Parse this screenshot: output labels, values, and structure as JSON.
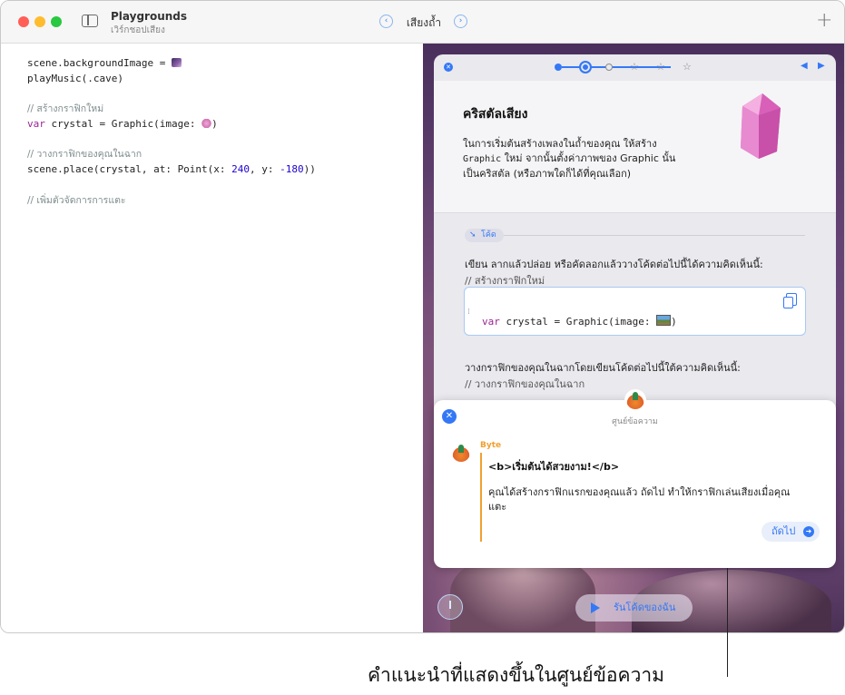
{
  "window": {
    "app_title": "Playgrounds",
    "subtitle": "เวิร์กชอปเสียง",
    "page_name": "เสียงถ้ำ",
    "nav_prev_icon": "chevron-left-icon",
    "nav_next_icon": "chevron-right-icon",
    "add_icon": "plus-icon"
  },
  "editor": {
    "lines": {
      "l1": "scene.backgroundImage = ",
      "l2": "playMusic(.cave)",
      "c1": "// สร้างกราฟิกใหม่",
      "l3_kw": "var",
      "l3_a": " crystal = Graphic(image: ",
      "l3_b": ")",
      "c2": "// วางกราฟิกของคุณในฉาก",
      "l4_a": "scene.place(crystal, at: Point(x: ",
      "l4_x": "240",
      "l4_b": ", y: ",
      "l4_y": "-180",
      "l4_c": "))",
      "c3": "// เพิ่มตัวจัดการการแตะ"
    }
  },
  "guide": {
    "progress": {
      "current_step": 2,
      "total_steps": 6
    },
    "title": "คริสตัลเสียง",
    "intro_a": "ในการเริ่มต้นสร้างเพลงในถ้ำของคุณ ให้สร้าง",
    "intro_mono": "Graphic",
    "intro_b": " ใหม่ จากนั้นตั้งค่าภาพของ Graphic นั้นเป็นคริสตัล (หรือภาพใดก็ได้ที่คุณเลือก)",
    "code_tag": "โค้ด",
    "instr1": "เขียน ลากแล้วปล่อย หรือคัดลอกแล้ววางโค้ดต่อไปนี้ได้ความคิดเห็นนี้:",
    "comment1": "// สร้างกราฟิกใหม่",
    "code_kw": "var",
    "code_a": " crystal = Graphic(image: ",
    "code_b": ")",
    "instr2": "วางกราฟิกของคุณในฉากโดยเขียนโค้ดต่อไปนี้ใต้ความคิดเห็นนี้:",
    "comment2": "// วางกราฟิกของคุณในฉาก"
  },
  "message_center": {
    "header": "ศูนย์ข้อความ",
    "sender": "Byte",
    "title": "<b>เริ่มต้นได้สวยงาม!</b>",
    "body": "คุณได้สร้างกราฟิกแรกของคุณแล้ว ถัดไป ทำให้กราฟิกเล่นเสียงเมื่อคุณแตะ",
    "next_label": "ถัดไป"
  },
  "controls": {
    "run_label": "รันโค้ดของฉัน"
  },
  "callout": "คำแนะนำที่แสดงขึ้นในศูนย์ข้อความ",
  "colors": {
    "accent": "#3478f6",
    "byte_orange": "#f0a030",
    "keyword": "#9b2393",
    "number": "#1c00cf"
  }
}
